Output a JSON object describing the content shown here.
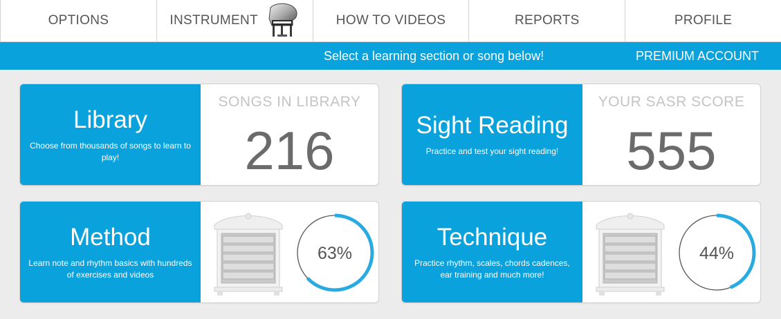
{
  "nav": {
    "items": [
      {
        "label": "OPTIONS"
      },
      {
        "label": "INSTRUMENT"
      },
      {
        "label": "HOW TO VIDEOS"
      },
      {
        "label": "REPORTS"
      },
      {
        "label": "PROFILE"
      }
    ],
    "instrument_icon": "grand-piano-icon"
  },
  "banner": {
    "message": "Select a learning section or song below!",
    "account": "PREMIUM ACCOUNT"
  },
  "cards": {
    "library": {
      "title": "Library",
      "description": "Choose from thousands of songs to learn to play!",
      "stat_label": "SONGS IN LIBRARY",
      "stat_value": "216"
    },
    "sight_reading": {
      "title": "Sight Reading",
      "description": "Practice and test your sight reading!",
      "stat_label": "YOUR SASR SCORE",
      "stat_value": "555"
    },
    "method": {
      "title": "Method",
      "description": "Learn note and rhythm basics with hundreds of exercises and videos",
      "progress_label": "63%",
      "progress": 0.63,
      "icon": "cabinet-icon"
    },
    "technique": {
      "title": "Technique",
      "description": "Practice rhythm, scales, chords cadences, ear training and much more!",
      "progress_label": "44%",
      "progress": 0.44,
      "icon": "cabinet-icon"
    }
  },
  "colors": {
    "accent": "#0aa2dc",
    "progress_track": "#555555",
    "progress_fill": "#29abe2"
  }
}
